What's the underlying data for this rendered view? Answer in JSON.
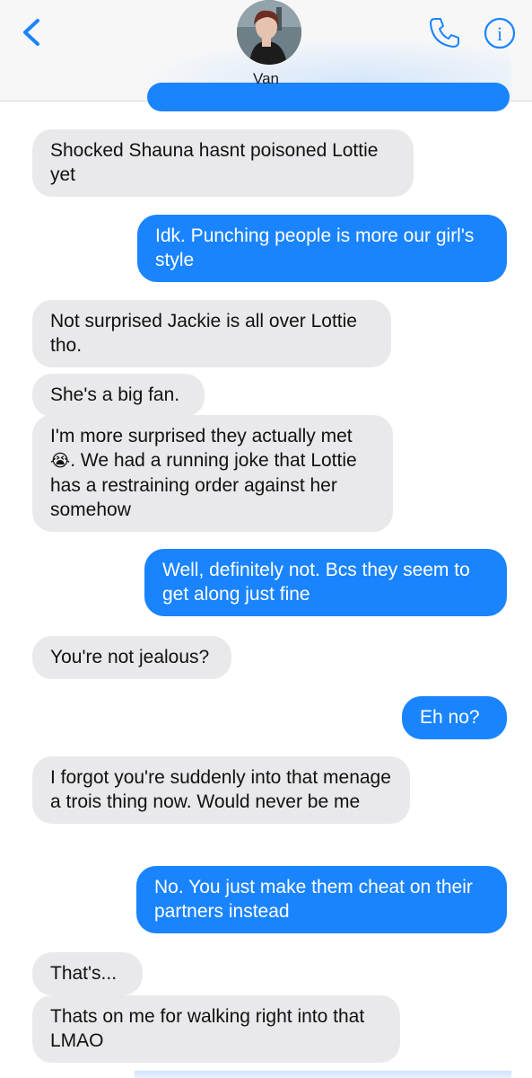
{
  "header": {
    "contact_name": "Van",
    "back_icon": "chevron-left-icon",
    "call_icon": "phone-icon",
    "info_icon": "info-icon",
    "info_glyph": "i",
    "accent_color": "#1a84ff"
  },
  "messages": [
    {
      "from": "them",
      "text": "Shocked Shauna hasnt poisoned Lottie yet"
    },
    {
      "from": "me",
      "text": "Idk. Punching people is more our girl's style"
    },
    {
      "from": "them",
      "text": "Not surprised Jackie is all over Lottie tho."
    },
    {
      "from": "them",
      "text": "She's a big fan."
    },
    {
      "from": "them",
      "text_before": "I'm more surprised they actually met",
      "emoji": "😭",
      "text_after": ". We had a running joke that Lottie has a restraining order against her somehow"
    },
    {
      "from": "me",
      "text": "Well, definitely not. Bcs they seem to get along just fine"
    },
    {
      "from": "them",
      "text": "You're not jealous?"
    },
    {
      "from": "me",
      "text": "Eh no?"
    },
    {
      "from": "them",
      "text": "I forgot you're suddenly into that menage a trois thing now. Would never be me"
    },
    {
      "from": "me",
      "text": "No. You just make them cheat on their partners instead"
    },
    {
      "from": "them",
      "text": "That's..."
    },
    {
      "from": "them",
      "text": "Thats on me for walking right into that LMAO"
    }
  ],
  "colors": {
    "sent_bubble": "#1a84ff",
    "received_bubble": "#e9e9eb",
    "header_background": "#f7f7f8"
  }
}
